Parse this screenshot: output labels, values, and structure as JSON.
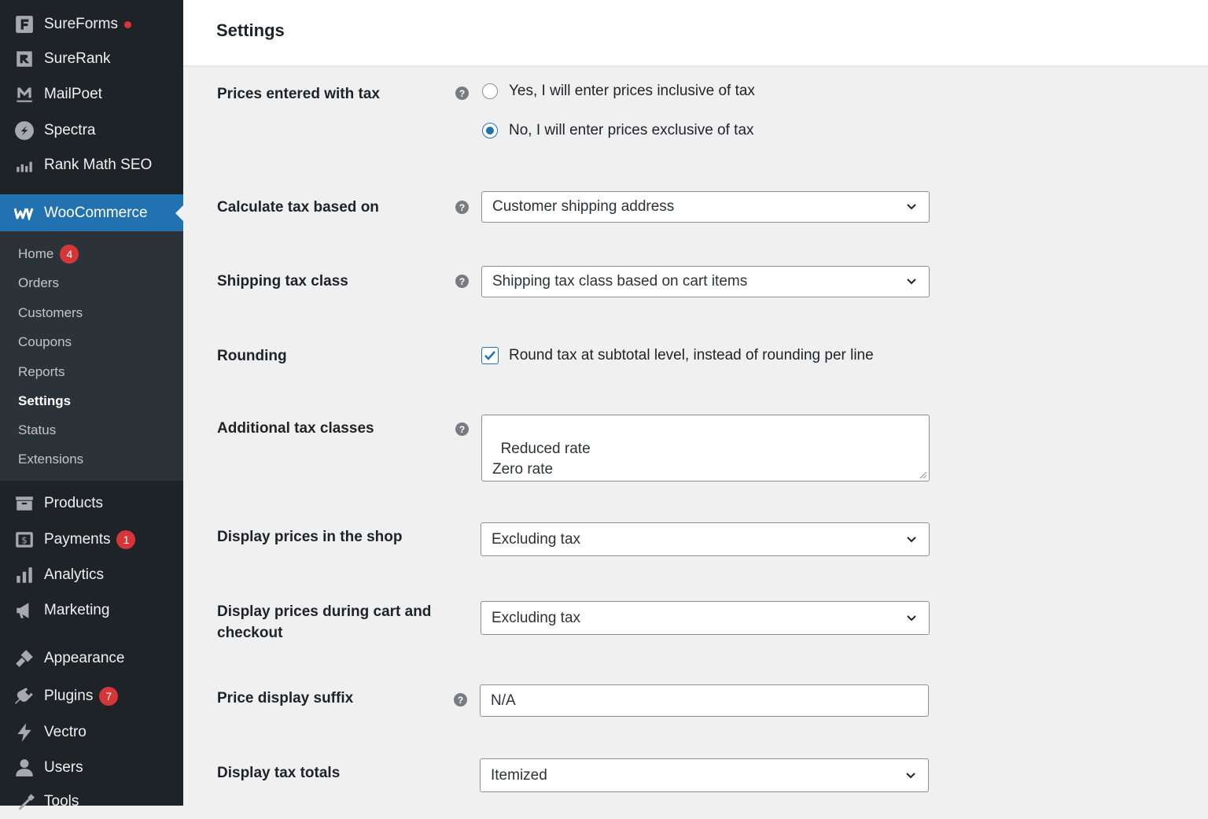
{
  "sidebar": {
    "top_items": [
      {
        "label": "SureForms",
        "icon": "sureforms-icon",
        "indicator": "red-dot"
      },
      {
        "label": "SureRank",
        "icon": "surerank-icon"
      },
      {
        "label": "MailPoet",
        "icon": "mailpoet-icon"
      },
      {
        "label": "Spectra",
        "icon": "spectra-icon"
      },
      {
        "label": "Rank Math SEO",
        "icon": "rank-math-icon"
      }
    ],
    "active_item": {
      "label": "WooCommerce",
      "icon": "woocommerce-icon"
    },
    "submenu": [
      {
        "label": "Home",
        "badge": "4"
      },
      {
        "label": "Orders"
      },
      {
        "label": "Customers"
      },
      {
        "label": "Coupons"
      },
      {
        "label": "Reports"
      },
      {
        "label": "Settings",
        "current": true
      },
      {
        "label": "Status"
      },
      {
        "label": "Extensions"
      }
    ],
    "bottom_items": [
      {
        "label": "Products",
        "icon": "products-icon"
      },
      {
        "label": "Payments",
        "icon": "payments-icon",
        "badge": "1"
      },
      {
        "label": "Analytics",
        "icon": "analytics-icon"
      },
      {
        "label": "Marketing",
        "icon": "marketing-icon"
      },
      {
        "label": "Appearance",
        "icon": "appearance-icon"
      },
      {
        "label": "Plugins",
        "icon": "plugins-icon",
        "badge": "7"
      },
      {
        "label": "Vectro",
        "icon": "vectro-icon"
      },
      {
        "label": "Users",
        "icon": "users-icon"
      },
      {
        "label": "Tools",
        "icon": "tools-icon"
      }
    ]
  },
  "header": {
    "title": "Settings"
  },
  "form": {
    "prices_entered_with_tax": {
      "label": "Prices entered with tax",
      "options": [
        {
          "label": "Yes, I will enter prices inclusive of tax",
          "selected": false
        },
        {
          "label": "No, I will enter prices exclusive of tax",
          "selected": true
        }
      ]
    },
    "calculate_tax_based_on": {
      "label": "Calculate tax based on",
      "value": "Customer shipping address"
    },
    "shipping_tax_class": {
      "label": "Shipping tax class",
      "value": "Shipping tax class based on cart items"
    },
    "rounding": {
      "label": "Rounding",
      "checkbox_label": "Round tax at subtotal level, instead of rounding per line",
      "checked": true
    },
    "additional_tax_classes": {
      "label": "Additional tax classes",
      "value": "Reduced rate\nZero rate"
    },
    "display_prices_in_shop": {
      "label": "Display prices in the shop",
      "value": "Excluding tax"
    },
    "display_prices_cart_checkout": {
      "label_line1": "Display prices during cart and",
      "label_line2": "checkout",
      "value": "Excluding tax"
    },
    "price_display_suffix": {
      "label": "Price display suffix",
      "value": "N/A"
    },
    "display_tax_totals": {
      "label": "Display tax totals",
      "value": "Itemized"
    }
  },
  "colors": {
    "sidebar_bg": "#1d2327",
    "submenu_bg": "#2c3338",
    "accent": "#2271b1",
    "badge": "#d63638"
  }
}
